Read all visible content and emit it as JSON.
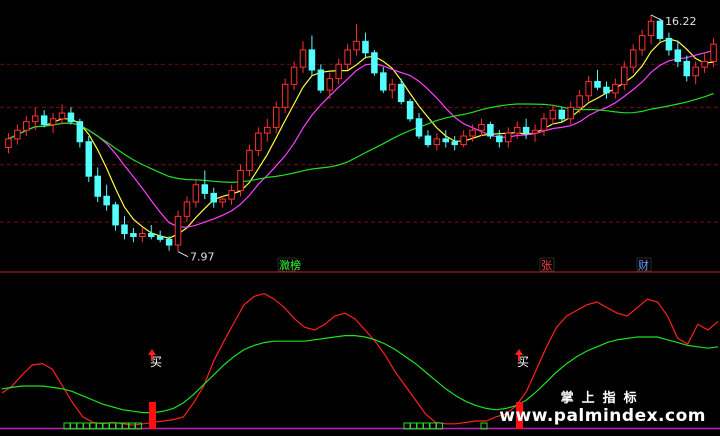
{
  "chart_data": [
    {
      "type": "candlestick",
      "panel": "price",
      "high_label": "16.22",
      "low_label": "7.97",
      "y_range": [
        7.4,
        16.6
      ],
      "grid": "dashed-horizontal",
      "colors": {
        "up": "#ff3030",
        "down": "#54ffff",
        "ma_short": "#ffff40",
        "ma_mid": "#ff40ff",
        "ma_long": "#20e020"
      },
      "candles": [
        [
          11.6,
          12.1,
          11.4,
          11.9
        ],
        [
          11.9,
          12.4,
          11.7,
          12.2
        ],
        [
          12.2,
          12.7,
          12.0,
          12.5
        ],
        [
          12.5,
          13.0,
          12.2,
          12.7
        ],
        [
          12.7,
          12.9,
          12.3,
          12.4
        ],
        [
          12.4,
          12.8,
          12.1,
          12.6
        ],
        [
          12.6,
          13.1,
          12.4,
          12.8
        ],
        [
          12.8,
          13.0,
          12.4,
          12.5
        ],
        [
          12.5,
          12.6,
          11.6,
          11.8
        ],
        [
          11.8,
          12.0,
          10.4,
          10.6
        ],
        [
          10.6,
          10.9,
          9.7,
          9.9
        ],
        [
          9.9,
          10.3,
          9.4,
          9.6
        ],
        [
          9.6,
          9.7,
          8.7,
          8.9
        ],
        [
          8.9,
          9.2,
          8.4,
          8.6
        ],
        [
          8.6,
          8.8,
          8.3,
          8.5
        ],
        [
          8.5,
          8.8,
          8.3,
          8.6
        ],
        [
          8.6,
          8.9,
          8.4,
          8.5
        ],
        [
          8.5,
          8.7,
          8.3,
          8.4
        ],
        [
          8.4,
          8.5,
          8.0,
          8.2
        ],
        [
          8.2,
          9.4,
          7.97,
          9.2
        ],
        [
          9.2,
          9.9,
          9.0,
          9.7
        ],
        [
          9.7,
          10.5,
          9.5,
          10.3
        ],
        [
          10.3,
          10.8,
          9.8,
          10.0
        ],
        [
          10.0,
          10.2,
          9.5,
          9.7
        ],
        [
          9.7,
          9.9,
          9.5,
          9.8
        ],
        [
          9.8,
          10.3,
          9.6,
          10.1
        ],
        [
          10.1,
          11.0,
          9.9,
          10.8
        ],
        [
          10.8,
          11.7,
          10.6,
          11.5
        ],
        [
          11.5,
          12.3,
          11.3,
          12.1
        ],
        [
          12.1,
          12.6,
          11.8,
          12.3
        ],
        [
          12.3,
          13.2,
          12.1,
          13.0
        ],
        [
          13.0,
          14.0,
          12.8,
          13.8
        ],
        [
          13.8,
          14.6,
          13.6,
          14.4
        ],
        [
          14.4,
          15.3,
          14.2,
          15.0
        ],
        [
          15.0,
          15.5,
          14.1,
          14.3
        ],
        [
          14.3,
          14.5,
          13.5,
          13.6
        ],
        [
          13.6,
          14.2,
          13.3,
          14.0
        ],
        [
          14.0,
          14.7,
          13.8,
          14.5
        ],
        [
          14.5,
          15.2,
          14.3,
          15.0
        ],
        [
          15.0,
          15.9,
          14.8,
          15.3
        ],
        [
          15.3,
          15.6,
          14.7,
          14.9
        ],
        [
          14.9,
          15.0,
          14.1,
          14.2
        ],
        [
          14.2,
          14.4,
          13.5,
          13.6
        ],
        [
          13.6,
          14.0,
          13.3,
          13.8
        ],
        [
          13.8,
          14.0,
          13.1,
          13.2
        ],
        [
          13.2,
          13.3,
          12.5,
          12.6
        ],
        [
          12.6,
          12.8,
          11.9,
          12.0
        ],
        [
          12.0,
          12.2,
          11.6,
          11.7
        ],
        [
          11.7,
          12.1,
          11.5,
          11.9
        ],
        [
          11.9,
          12.2,
          11.6,
          11.8
        ],
        [
          11.8,
          12.0,
          11.5,
          11.7
        ],
        [
          11.7,
          12.2,
          11.6,
          12.0
        ],
        [
          12.0,
          12.4,
          11.8,
          12.2
        ],
        [
          12.2,
          12.6,
          12.0,
          12.4
        ],
        [
          12.4,
          12.5,
          11.9,
          12.0
        ],
        [
          12.0,
          12.2,
          11.6,
          11.8
        ],
        [
          11.8,
          12.3,
          11.6,
          12.1
        ],
        [
          12.1,
          12.5,
          11.9,
          12.3
        ],
        [
          12.3,
          12.6,
          11.9,
          12.1
        ],
        [
          12.1,
          12.4,
          11.8,
          12.2
        ],
        [
          12.2,
          12.8,
          12.0,
          12.6
        ],
        [
          12.6,
          13.1,
          12.4,
          12.9
        ],
        [
          12.9,
          13.0,
          12.5,
          12.6
        ],
        [
          12.6,
          13.2,
          12.4,
          13.0
        ],
        [
          13.0,
          13.6,
          12.8,
          13.4
        ],
        [
          13.4,
          14.1,
          13.2,
          13.9
        ],
        [
          13.9,
          14.3,
          13.6,
          13.7
        ],
        [
          13.7,
          13.9,
          13.3,
          13.5
        ],
        [
          13.5,
          14.0,
          13.3,
          13.8
        ],
        [
          13.8,
          14.6,
          13.6,
          14.4
        ],
        [
          14.4,
          15.2,
          14.2,
          15.0
        ],
        [
          15.0,
          15.7,
          14.8,
          15.5
        ],
        [
          15.5,
          16.22,
          15.2,
          16.0
        ],
        [
          16.0,
          16.1,
          15.3,
          15.4
        ],
        [
          15.4,
          15.6,
          14.8,
          15.0
        ],
        [
          15.0,
          15.3,
          14.4,
          14.6
        ],
        [
          14.6,
          14.8,
          13.9,
          14.1
        ],
        [
          14.1,
          14.6,
          13.8,
          14.4
        ],
        [
          14.4,
          14.9,
          14.2,
          14.6
        ],
        [
          14.6,
          15.4,
          14.4,
          15.2
        ]
      ]
    },
    {
      "type": "line",
      "panel": "indicator",
      "y_range": [
        0,
        100
      ],
      "series": [
        {
          "color": "#ff2020",
          "values": [
            25,
            30,
            38,
            45,
            46,
            42,
            30,
            18,
            8,
            4,
            3,
            4,
            3,
            2,
            3,
            4,
            5,
            6,
            8,
            18,
            30,
            48,
            62,
            75,
            88,
            94,
            96,
            92,
            86,
            78,
            72,
            70,
            74,
            80,
            82,
            78,
            70,
            62,
            52,
            40,
            30,
            20,
            10,
            4,
            3,
            3,
            4,
            5,
            5,
            8,
            10,
            16,
            26,
            42,
            58,
            72,
            80,
            84,
            88,
            90,
            86,
            82,
            80,
            86,
            92,
            90,
            80,
            64,
            60,
            74,
            70,
            76
          ]
        },
        {
          "color": "#20e020",
          "values": [
            28,
            29,
            30,
            30,
            30,
            29,
            28,
            26,
            23,
            20,
            17,
            15,
            13,
            12,
            11,
            11,
            12,
            14,
            18,
            24,
            31,
            38,
            45,
            51,
            56,
            59,
            61,
            62,
            62,
            62,
            62,
            63,
            64,
            65,
            66,
            66,
            65,
            63,
            60,
            56,
            51,
            46,
            40,
            34,
            28,
            23,
            19,
            16,
            14,
            13,
            14,
            16,
            20,
            26,
            33,
            40,
            46,
            51,
            55,
            58,
            61,
            63,
            64,
            65,
            65,
            65,
            63,
            61,
            59,
            58,
            57,
            58
          ]
        }
      ],
      "buy_label": "买"
    }
  ],
  "badges": [
    {
      "text": "㵟榜"
    },
    {
      "text": "张"
    },
    {
      "text": "财"
    }
  ],
  "watermark": {
    "line1": "掌上指标",
    "line2": "www.palmindex.com"
  }
}
